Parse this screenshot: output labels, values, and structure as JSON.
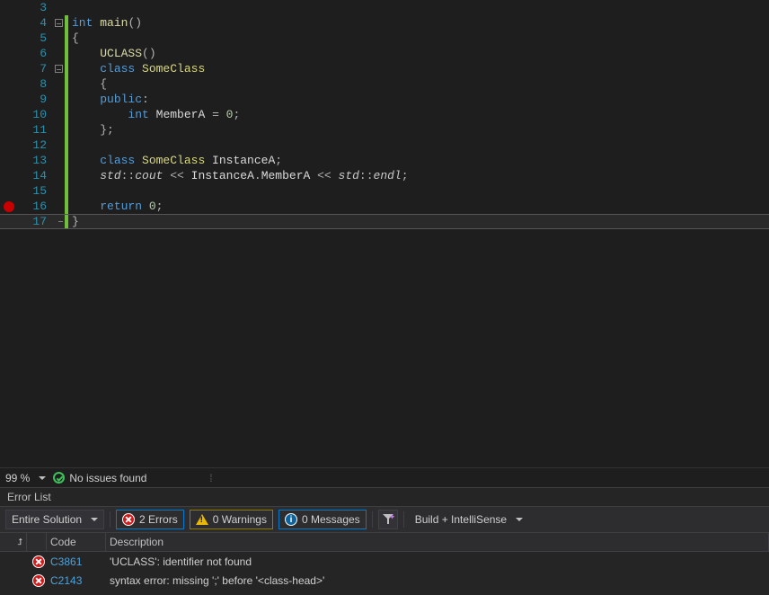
{
  "editor": {
    "lines": [
      {
        "n": 3,
        "fold": "",
        "change": false,
        "current": false,
        "bp": false,
        "tokens": []
      },
      {
        "n": 4,
        "fold": "minus",
        "change": true,
        "current": false,
        "bp": false,
        "tokens": [
          {
            "t": "int ",
            "c": "tk-keyword"
          },
          {
            "t": "main",
            "c": "tk-func"
          },
          {
            "t": "()",
            "c": "tk-op"
          }
        ]
      },
      {
        "n": 5,
        "fold": "bar",
        "change": true,
        "current": false,
        "bp": false,
        "tokens": [
          {
            "t": "{",
            "c": "tk-op"
          }
        ]
      },
      {
        "n": 6,
        "fold": "bar",
        "change": true,
        "current": false,
        "bp": false,
        "tokens": [
          {
            "t": "    ",
            "c": ""
          },
          {
            "t": "UCLASS",
            "c": "tk-func"
          },
          {
            "t": "()",
            "c": "tk-op"
          }
        ]
      },
      {
        "n": 7,
        "fold": "minus",
        "change": true,
        "current": false,
        "bp": false,
        "tokens": [
          {
            "t": "    ",
            "c": ""
          },
          {
            "t": "class ",
            "c": "tk-keyword"
          },
          {
            "t": "SomeClass",
            "c": "tk-class"
          }
        ]
      },
      {
        "n": 8,
        "fold": "bar",
        "change": true,
        "current": false,
        "bp": false,
        "tokens": [
          {
            "t": "    ",
            "c": ""
          },
          {
            "t": "{",
            "c": "tk-op"
          }
        ]
      },
      {
        "n": 9,
        "fold": "bar",
        "change": true,
        "current": false,
        "bp": false,
        "tokens": [
          {
            "t": "    ",
            "c": ""
          },
          {
            "t": "public",
            "c": "tk-keyword"
          },
          {
            "t": ":",
            "c": "tk-op"
          }
        ]
      },
      {
        "n": 10,
        "fold": "bar",
        "change": true,
        "current": false,
        "bp": false,
        "tokens": [
          {
            "t": "        ",
            "c": ""
          },
          {
            "t": "int ",
            "c": "tk-keyword"
          },
          {
            "t": "MemberA ",
            "c": "tk-field"
          },
          {
            "t": "= ",
            "c": "tk-op"
          },
          {
            "t": "0",
            "c": "tk-number"
          },
          {
            "t": ";",
            "c": "tk-op"
          }
        ]
      },
      {
        "n": 11,
        "fold": "bar",
        "change": true,
        "current": false,
        "bp": false,
        "tokens": [
          {
            "t": "    ",
            "c": ""
          },
          {
            "t": "};",
            "c": "tk-op"
          }
        ]
      },
      {
        "n": 12,
        "fold": "bar",
        "change": true,
        "current": false,
        "bp": false,
        "tokens": []
      },
      {
        "n": 13,
        "fold": "bar",
        "change": true,
        "current": false,
        "bp": false,
        "tokens": [
          {
            "t": "    ",
            "c": ""
          },
          {
            "t": "class ",
            "c": "tk-keyword"
          },
          {
            "t": "SomeClass ",
            "c": "tk-class"
          },
          {
            "t": "InstanceA",
            "c": "tk-field"
          },
          {
            "t": ";",
            "c": "tk-op"
          }
        ]
      },
      {
        "n": 14,
        "fold": "bar",
        "change": true,
        "current": false,
        "bp": false,
        "tokens": [
          {
            "t": "    ",
            "c": ""
          },
          {
            "t": "std",
            "c": "tk-std"
          },
          {
            "t": "::",
            "c": "tk-op"
          },
          {
            "t": "cout ",
            "c": "tk-std"
          },
          {
            "t": "<< ",
            "c": "tk-op"
          },
          {
            "t": "InstanceA",
            "c": "tk-field"
          },
          {
            "t": ".",
            "c": "tk-op"
          },
          {
            "t": "MemberA ",
            "c": "tk-field"
          },
          {
            "t": "<< ",
            "c": "tk-op"
          },
          {
            "t": "std",
            "c": "tk-std"
          },
          {
            "t": "::",
            "c": "tk-op"
          },
          {
            "t": "endl",
            "c": "tk-std"
          },
          {
            "t": ";",
            "c": "tk-op"
          }
        ]
      },
      {
        "n": 15,
        "fold": "bar",
        "change": true,
        "current": false,
        "bp": false,
        "tokens": []
      },
      {
        "n": 16,
        "fold": "bar",
        "change": true,
        "current": false,
        "bp": true,
        "tokens": [
          {
            "t": "    ",
            "c": ""
          },
          {
            "t": "return ",
            "c": "tk-keyword"
          },
          {
            "t": "0",
            "c": "tk-number"
          },
          {
            "t": ";",
            "c": "tk-op"
          }
        ]
      },
      {
        "n": 17,
        "fold": "end",
        "change": true,
        "current": true,
        "bp": false,
        "tokens": [
          {
            "t": "}",
            "c": "tk-op"
          }
        ]
      }
    ]
  },
  "status": {
    "zoom": "99 %",
    "issues": "No issues found"
  },
  "panel": {
    "title": "Error List",
    "scope": "Entire Solution",
    "errors_label": "2 Errors",
    "warnings_label": "0 Warnings",
    "messages_label": "0 Messages",
    "mode": "Build + IntelliSense",
    "columns": {
      "code": "Code",
      "description": "Description"
    },
    "rows": [
      {
        "code": "C3861",
        "desc": "'UCLASS': identifier not found"
      },
      {
        "code": "C2143",
        "desc": "syntax error: missing ';' before '<class-head>'"
      }
    ]
  }
}
